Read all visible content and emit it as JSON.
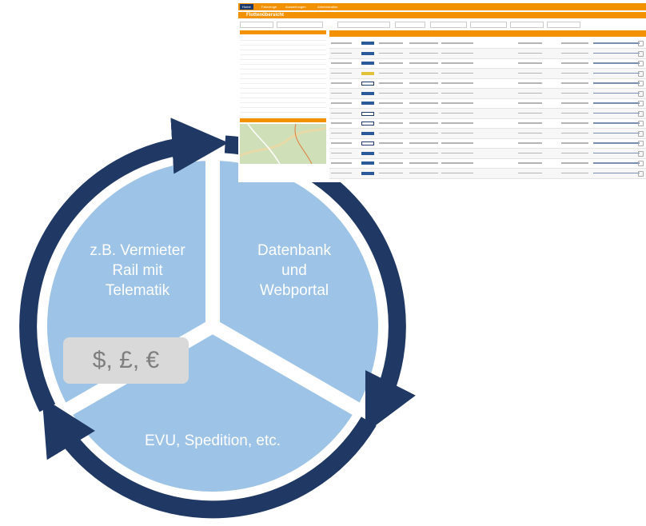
{
  "colors": {
    "circle_fill": "#9dc3e6",
    "arrow": "#1f3864",
    "separator": "#ffffff",
    "currency_box": "#d9d9d9",
    "currency_text": "#7f7f7f",
    "portal_orange": "#f39200",
    "portal_navy": "#1c3a6b"
  },
  "segments": [
    {
      "id": "vermieter",
      "lines": [
        "z.B. Vermieter",
        "Rail mit",
        "Telematik"
      ]
    },
    {
      "id": "datenbank",
      "lines": [
        "Datenbank",
        "und",
        "Webportal"
      ]
    },
    {
      "id": "evu",
      "lines": [
        "EVU, Spedition, etc."
      ]
    }
  ],
  "currency_badge": "$, £, €",
  "screenshot": {
    "title": "Flottenübersicht",
    "nav": [
      "Home",
      "Fahrzeuge",
      "Auswertungen",
      "Administration"
    ]
  }
}
